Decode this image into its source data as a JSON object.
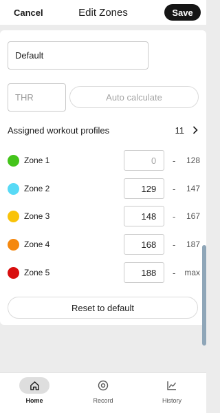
{
  "header": {
    "cancel_label": "Cancel",
    "title": "Edit Zones",
    "save_label": "Save"
  },
  "form": {
    "name_value": "Default",
    "thr_placeholder": "THR",
    "auto_calculate_label": "Auto calculate",
    "profiles_label": "Assigned workout profiles",
    "profiles_count": "11",
    "reset_label": "Reset to default"
  },
  "zones": [
    {
      "label": "Zone 1",
      "color": "#44c41b",
      "min": "0",
      "max": "128"
    },
    {
      "label": "Zone 2",
      "color": "#58daf6",
      "min": "129",
      "max": "147"
    },
    {
      "label": "Zone 3",
      "color": "#f9c309",
      "min": "148",
      "max": "167"
    },
    {
      "label": "Zone 4",
      "color": "#f5880f",
      "min": "168",
      "max": "187"
    },
    {
      "label": "Zone 5",
      "color": "#d80e0e",
      "min": "188",
      "max": "max"
    }
  ],
  "range_separator": "-",
  "nav": {
    "items": [
      {
        "label": "Home",
        "icon": "home-icon",
        "active": true
      },
      {
        "label": "Record",
        "icon": "record-icon",
        "active": false
      },
      {
        "label": "History",
        "icon": "chart-icon",
        "active": false
      }
    ]
  }
}
